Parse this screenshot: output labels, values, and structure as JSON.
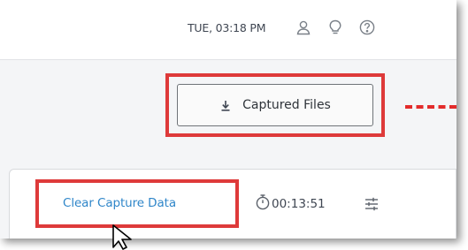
{
  "header": {
    "datetime": "TUE, 03:18 PM",
    "icons": [
      "user-icon",
      "lightbulb-icon",
      "help-icon"
    ]
  },
  "toolbar": {
    "captured_files_label": "Captured Files",
    "captured_files_icon": "download-icon"
  },
  "capture_panel": {
    "clear_label": "Clear Capture Data",
    "timer": "00:13:51",
    "timer_icon": "stopwatch-icon",
    "settings_icon": "sliders-icon"
  },
  "colors": {
    "highlight": "#de3a3a",
    "link": "#2f86c9"
  }
}
